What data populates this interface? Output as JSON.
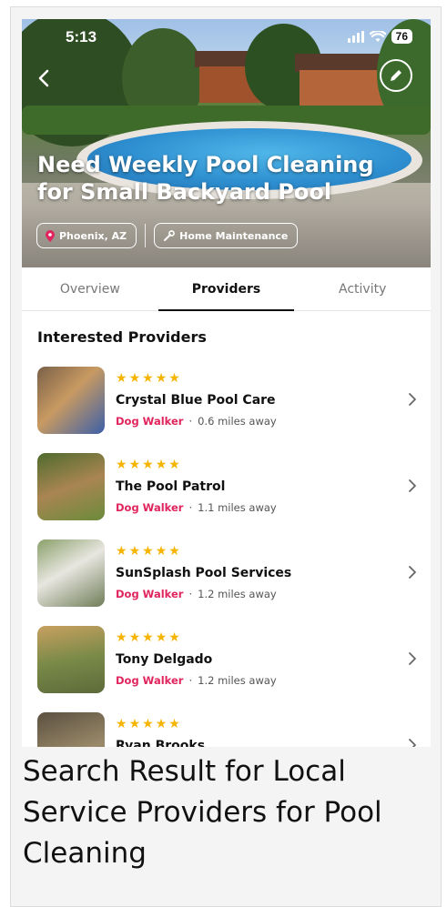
{
  "status_bar": {
    "time": "5:13",
    "battery": "76"
  },
  "hero": {
    "title": "Need Weekly Pool Cleaning for Small Backyard Pool",
    "location_chip": "Phoenix, AZ",
    "category_chip": "Home Maintenance"
  },
  "tabs": [
    {
      "label": "Overview",
      "active": false
    },
    {
      "label": "Providers",
      "active": true
    },
    {
      "label": "Activity",
      "active": false
    }
  ],
  "providers_section": {
    "title": "Interested Providers",
    "rating_stars": 5,
    "items": [
      {
        "name": "Crystal Blue Pool Care",
        "role": "Dog Walker",
        "distance": "0.6 miles away"
      },
      {
        "name": "The Pool Patrol",
        "role": "Dog Walker",
        "distance": "1.1 miles away"
      },
      {
        "name": "SunSplash Pool Services",
        "role": "Dog Walker",
        "distance": "1.2 miles away"
      },
      {
        "name": "Tony Delgado",
        "role": "Dog Walker",
        "distance": "1.2 miles away"
      },
      {
        "name": "Ryan Brooks",
        "role": "",
        "distance": ""
      }
    ]
  },
  "caption": "Search Result for Local Service Providers for Pool Cleaning",
  "colors": {
    "accent_pink": "#e0245e",
    "star_gold": "#f5b400"
  }
}
